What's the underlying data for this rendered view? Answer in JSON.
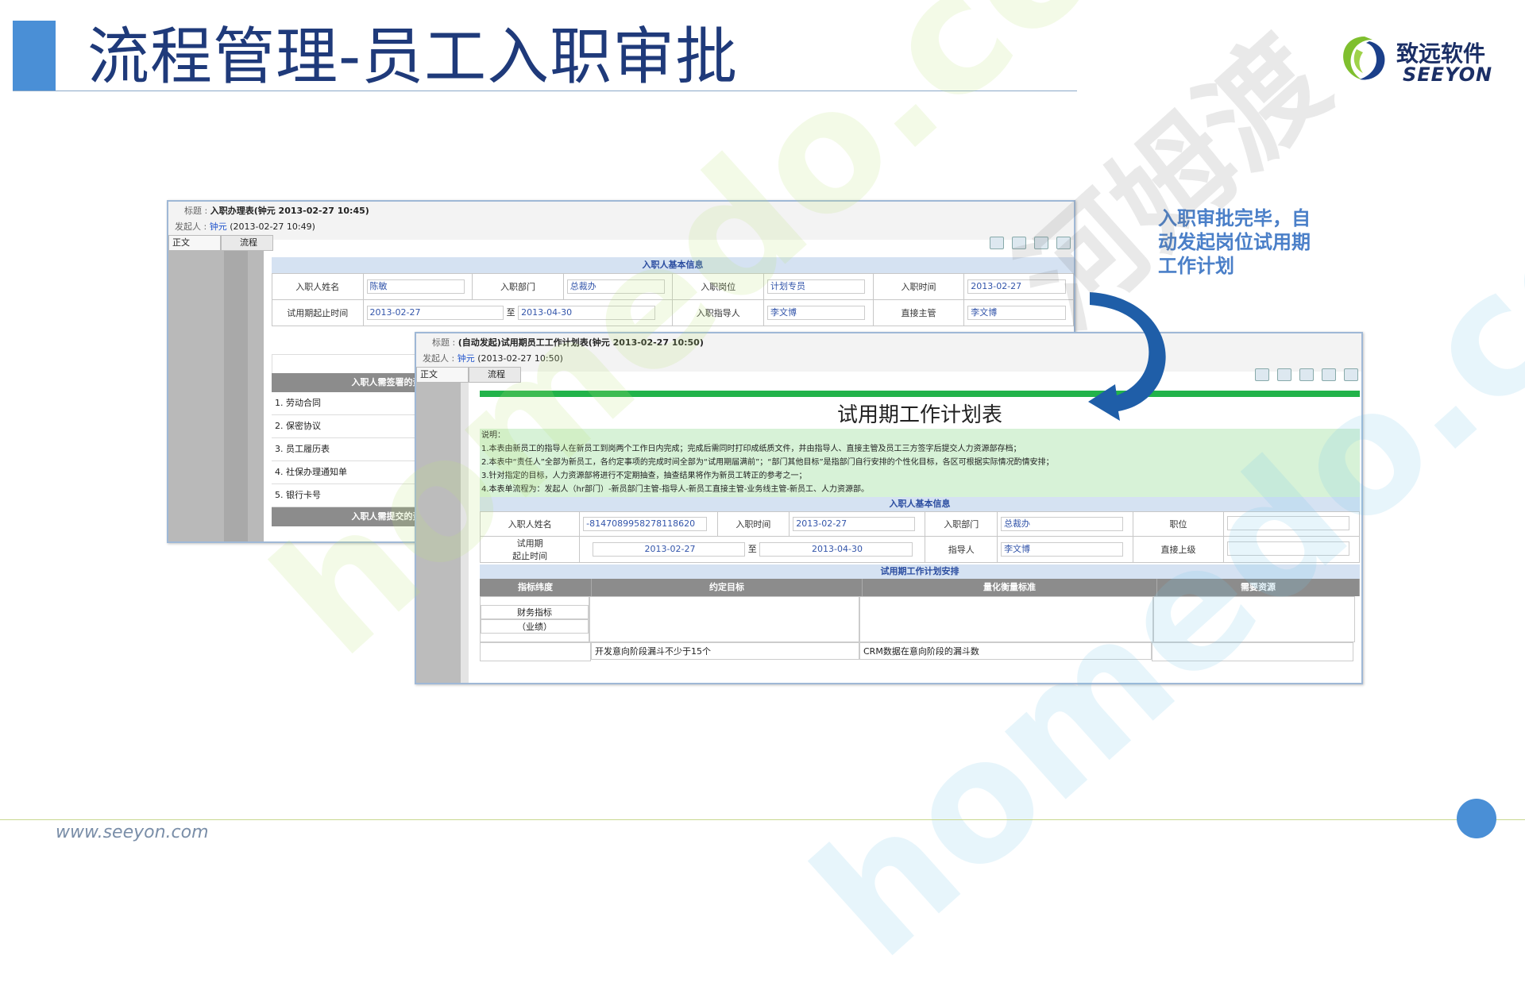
{
  "slide": {
    "title": "流程管理-员工入职审批",
    "logo_cn": "致远软件",
    "logo_en": "SEEYON",
    "footer_url": "www.seeyon.com",
    "callout": "入职审批完毕，自动发起岗位试用期工作计划",
    "watermarks": [
      "homedo.com",
      "homedo.com",
      "河姆渡"
    ]
  },
  "win1": {
    "title_label": "标题",
    "title_value": "入职办理表(钟元 2013-02-27 10:45)",
    "sender_label": "发起人",
    "sender_name": "钟元",
    "sender_time": "(2013-02-27 10:49)",
    "tab_body": "正文",
    "tab_flow": "流程",
    "band": "入职人基本信息",
    "r1": {
      "name_label": "入职人姓名",
      "name_value": "陈敏",
      "dept_label": "入职部门",
      "dept_value": "总裁办",
      "post_label": "入职岗位",
      "post_value": "计划专员",
      "date_label": "入职时间",
      "date_value": "2013-02-27"
    },
    "r2": {
      "period_label": "试用期起止时间",
      "start": "2013-02-27",
      "to": "至",
      "end": "2013-04-30",
      "mentor_label": "入职指导人",
      "mentor_value": "李文博",
      "boss_label": "直接主管",
      "boss_value": "李文博"
    },
    "sec1": "入职人需签署的资料",
    "items": [
      "1. 劳动合同",
      "2. 保密协议",
      "3. 员工履历表",
      "4. 社保办理通知单",
      "5. 银行卡号"
    ],
    "sec2": "入职人需提交的资料"
  },
  "win2": {
    "title_label": "标题",
    "title_value": "(自动发起)试用期员工工作计划表(钟元 2013-02-27 10:50)",
    "sender_label": "发起人",
    "sender_name": "钟元",
    "sender_time": "(2013-02-27 10:50)",
    "tab_body": "正文",
    "tab_flow": "流程",
    "page_title": "试用期工作计划表",
    "notes_label": "说明：",
    "notes": [
      "1.本表由新员工的指导人在新员工到岗两个工作日内完成；完成后需同时打印成纸质文件，并由指导人、直接主管及员工三方签字后提交人力资源部存档；",
      "2.本表中“责任人”全部为新员工，各约定事项的完成时间全部为“试用期届满前”；“部门其他目标”是指部门自行安排的个性化目标，各区可根据实际情况酌情安排；",
      "3.针对指定的目标，人力资源部将进行不定期抽查，抽查结果将作为新员工转正的参考之一；",
      "4.本表单流程为：发起人（hr部门）-新员部门主管-指导人-新员工直接主管-业务线主管-新员工、人力资源部。"
    ],
    "band1": "入职人基本信息",
    "r1": {
      "name_label": "入职人姓名",
      "name_value": "-8147089958278118620",
      "date_label": "入职时间",
      "date_value": "2013-02-27",
      "dept_label": "入职部门",
      "dept_value": "总裁办",
      "post_label": "职位",
      "post_value": ""
    },
    "r2": {
      "period_label1": "试用期",
      "period_label2": "起止时间",
      "start": "2013-02-27",
      "to": "至",
      "end": "2013-04-30",
      "mentor_label": "指导人",
      "mentor_value": "李文博",
      "boss_label": "直接上级",
      "boss_value": ""
    },
    "band2": "试用期工作计划安排",
    "cols": [
      "指标纬度",
      "约定目标",
      "量化衡量标准",
      "需要资源"
    ],
    "row1_label1": "财务指标",
    "row1_label2": "（业绩）",
    "row2_goal": "开发意向阶段漏斗不少于15个",
    "row2_measure": "CRM数据在意向阶段的漏斗数"
  }
}
